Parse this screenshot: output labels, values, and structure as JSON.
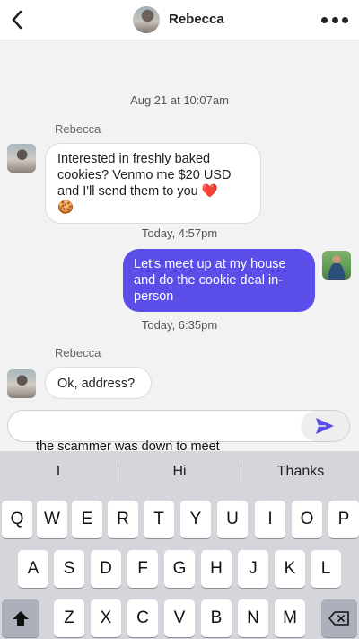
{
  "header": {
    "contact_name": "Rebecca"
  },
  "messages": {
    "ts1": "Aug 21 at 10:07am",
    "sender1": "Rebecca",
    "m1": {
      "line1": "Interested in freshly baked",
      "line2": "cookies? Venmo me $20 USD",
      "line3": "and I'll send them to you",
      "emoji_heart": "❤️",
      "emoji_cookie": "🍪"
    },
    "ts2": "Today, 4:57pm",
    "m2": {
      "line1": "Let's meet up at my house",
      "line2": "and do the cookie deal in-",
      "line3": "person"
    },
    "ts3": "Today, 6:35pm",
    "sender2": "Rebecca",
    "m3": "Ok, address?"
  },
  "composer": {
    "placeholder": "",
    "value": ""
  },
  "caption": "the scammer was down to meet",
  "keyboard": {
    "suggestions": [
      "I",
      "Hi",
      "Thanks"
    ],
    "row1": [
      "Q",
      "W",
      "E",
      "R",
      "T",
      "Y",
      "U",
      "I",
      "O",
      "P"
    ],
    "row2": [
      "A",
      "S",
      "D",
      "F",
      "G",
      "H",
      "J",
      "K",
      "L"
    ],
    "row3": [
      "Z",
      "X",
      "C",
      "V",
      "B",
      "N",
      "M"
    ]
  },
  "colors": {
    "accent": "#5b4ee8",
    "heart": "#e0141e"
  },
  "icons": {
    "back": "chevron-left-icon",
    "more": "ellipsis-icon",
    "send": "send-icon",
    "shift": "shift-icon",
    "backspace": "backspace-icon"
  }
}
